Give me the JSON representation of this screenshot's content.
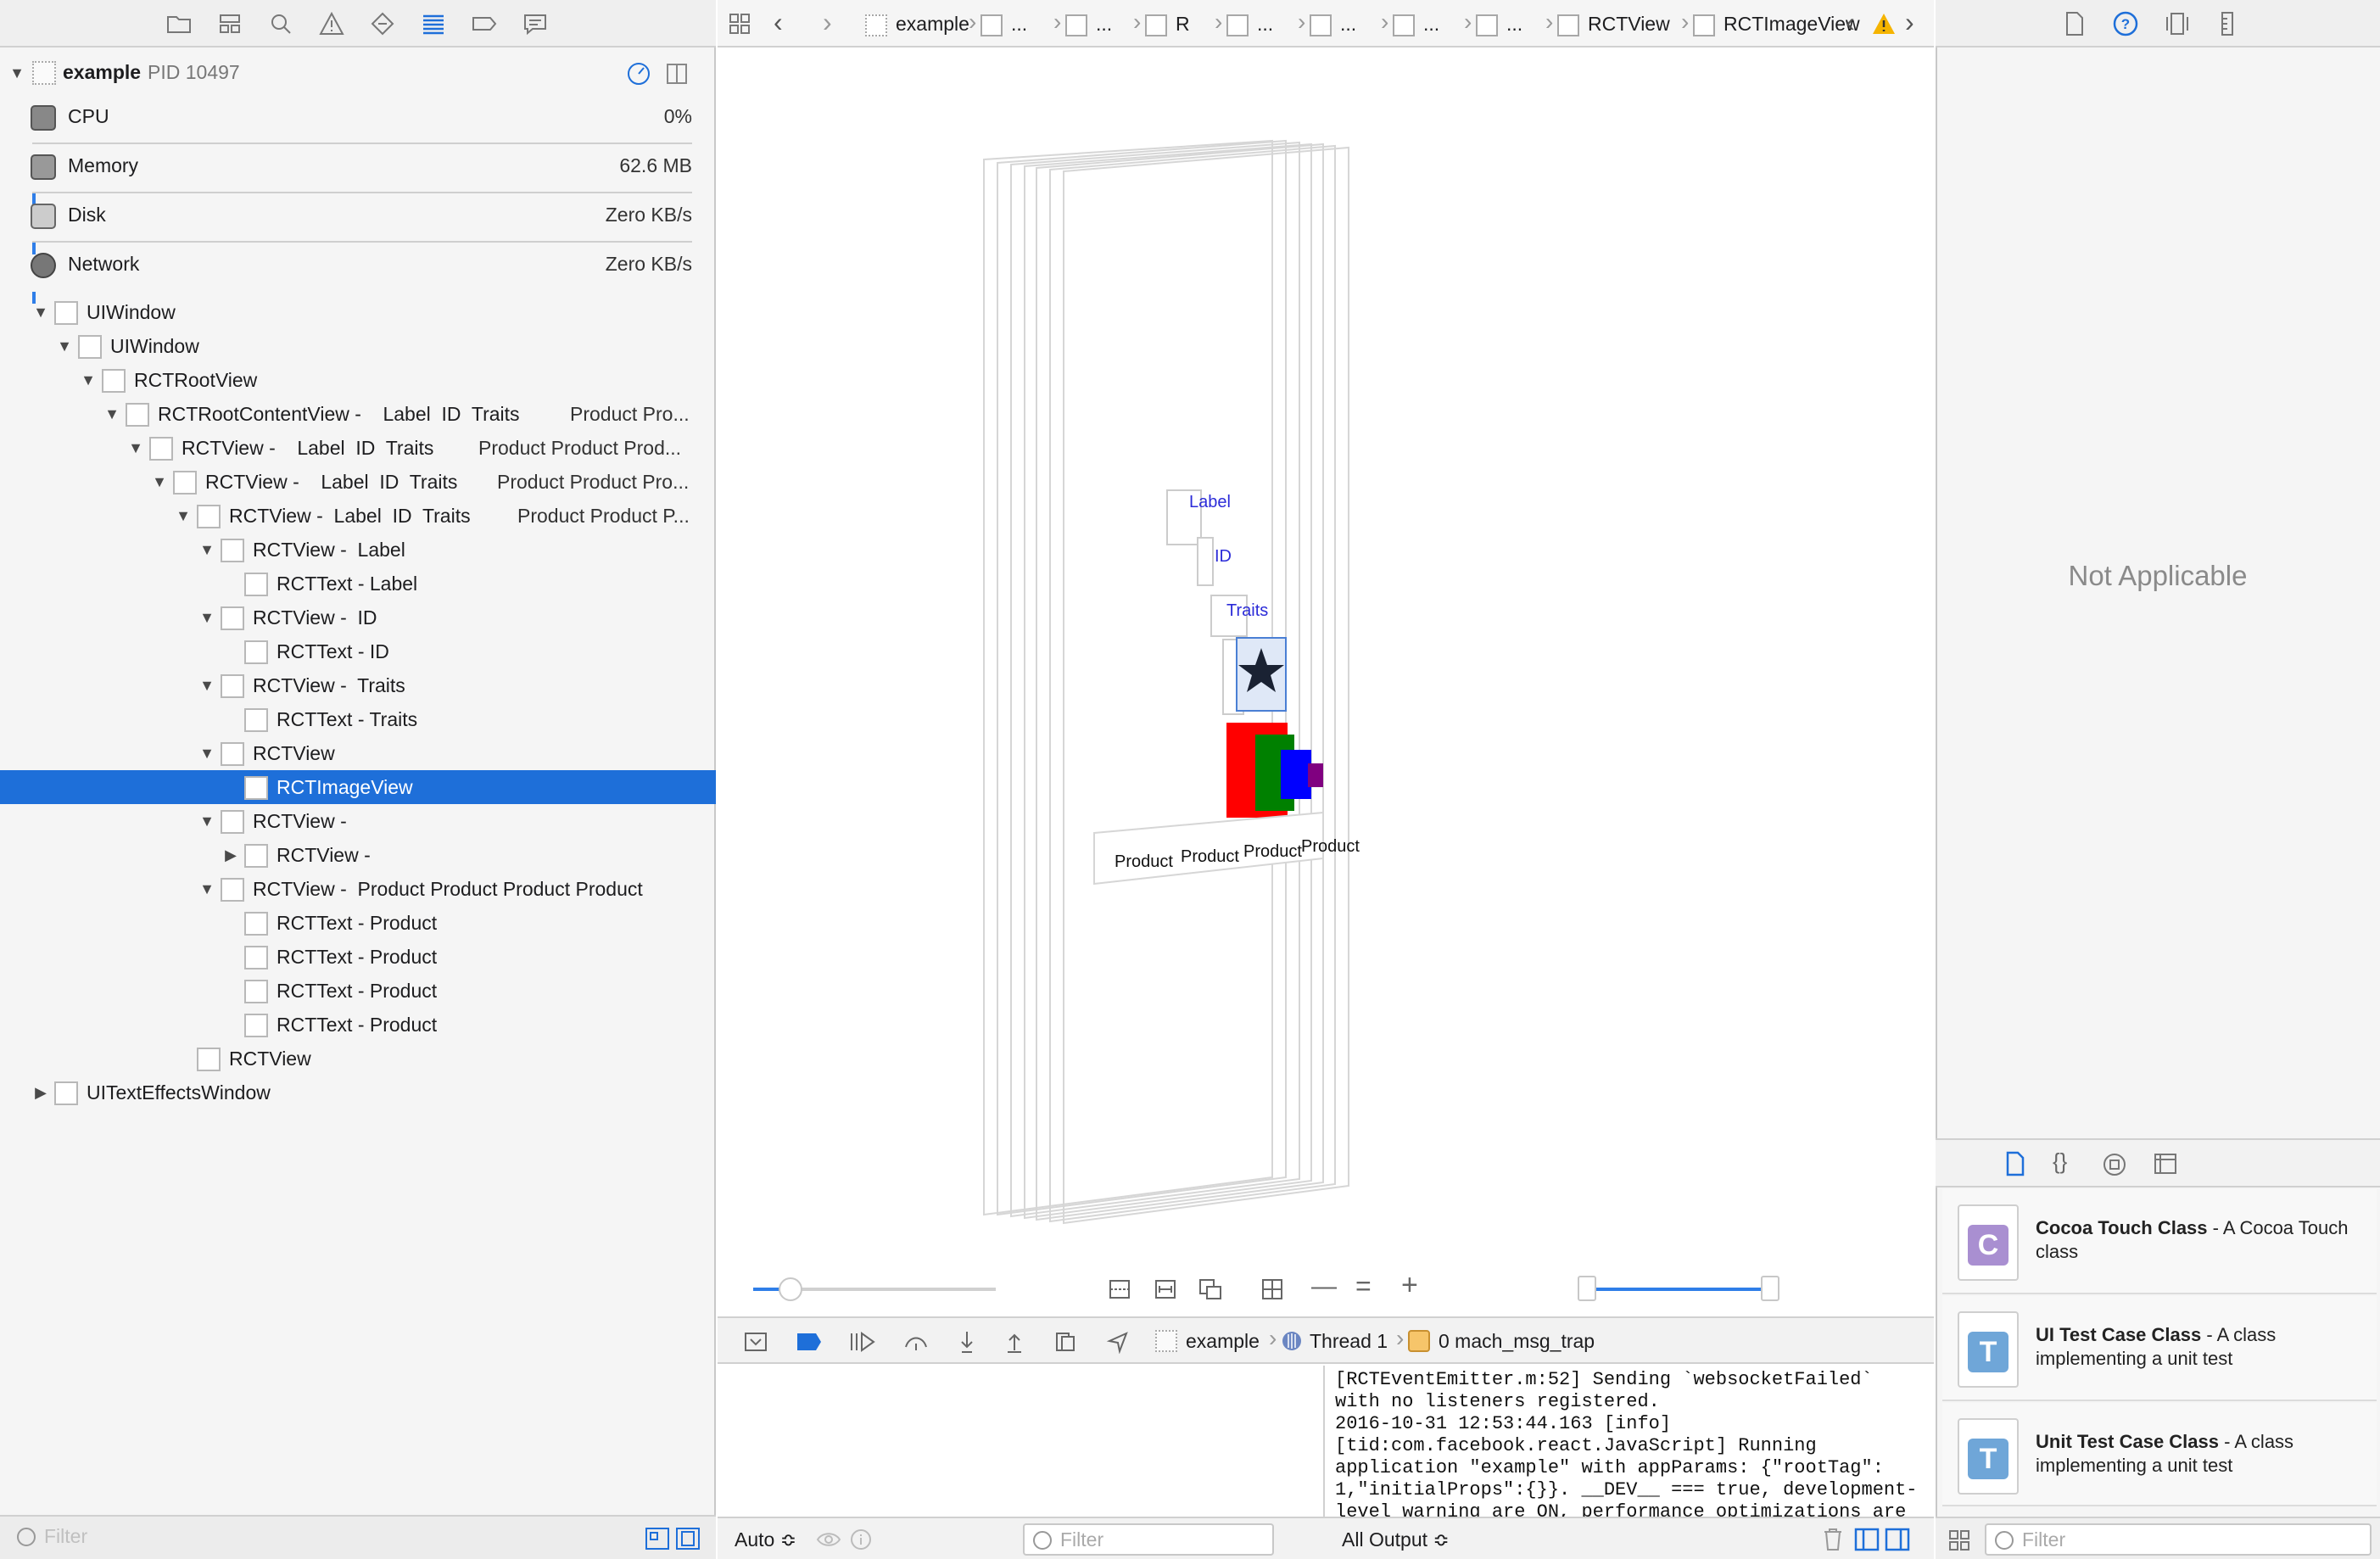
{
  "navigator": {
    "process": {
      "name": "example",
      "pid": "PID 10497"
    },
    "gauges": [
      {
        "label": "CPU",
        "value": "0%"
      },
      {
        "label": "Memory",
        "value": "62.6 MB"
      },
      {
        "label": "Disk",
        "value": "Zero KB/s"
      },
      {
        "label": "Network",
        "value": "Zero KB/s"
      }
    ],
    "tree": [
      {
        "label": "UIWindow",
        "extra": "",
        "indent": 0,
        "expand": "open"
      },
      {
        "label": "UIWindow",
        "extra": "",
        "indent": 1,
        "expand": "open"
      },
      {
        "label": "RCTRootView",
        "extra": "",
        "indent": 2,
        "expand": "open"
      },
      {
        "label": "RCTRootContentView -    Label  ID  Traits",
        "extra": "Product Pro...",
        "indent": 3,
        "expand": "open"
      },
      {
        "label": "RCTView -    Label  ID  Traits",
        "extra": "Product Product Prod...",
        "indent": 4,
        "expand": "open"
      },
      {
        "label": "RCTView -    Label  ID  Traits",
        "extra": "Product Product Pro...",
        "indent": 5,
        "expand": "open"
      },
      {
        "label": "RCTView -  Label  ID  Traits",
        "extra": "Product Product P...",
        "indent": 6,
        "expand": "open"
      },
      {
        "label": "RCTView -  Label",
        "extra": "",
        "indent": 7,
        "expand": "open"
      },
      {
        "label": "RCTText - Label",
        "extra": "",
        "indent": 8,
        "expand": "none"
      },
      {
        "label": "RCTView -  ID",
        "extra": "",
        "indent": 7,
        "expand": "open"
      },
      {
        "label": "RCTText - ID",
        "extra": "",
        "indent": 8,
        "expand": "none"
      },
      {
        "label": "RCTView -  Traits",
        "extra": "",
        "indent": 7,
        "expand": "open"
      },
      {
        "label": "RCTText - Traits",
        "extra": "",
        "indent": 8,
        "expand": "none"
      },
      {
        "label": "RCTView",
        "extra": "",
        "indent": 7,
        "expand": "open"
      },
      {
        "label": "RCTImageView",
        "extra": "",
        "indent": 8,
        "expand": "none",
        "selected": true
      },
      {
        "label": "RCTView -",
        "extra": "",
        "indent": 7,
        "expand": "open"
      },
      {
        "label": "RCTView -",
        "extra": "",
        "indent": 8,
        "expand": "closed"
      },
      {
        "label": "RCTView -  Product Product Product Product",
        "extra": "",
        "indent": 7,
        "expand": "open"
      },
      {
        "label": "RCTText - Product",
        "extra": "",
        "indent": 8,
        "expand": "none"
      },
      {
        "label": "RCTText - Product",
        "extra": "",
        "indent": 8,
        "expand": "none"
      },
      {
        "label": "RCTText - Product",
        "extra": "",
        "indent": 8,
        "expand": "none"
      },
      {
        "label": "RCTText - Product",
        "extra": "",
        "indent": 8,
        "expand": "none"
      },
      {
        "label": "RCTView",
        "extra": "",
        "indent": 6,
        "expand": "none"
      },
      {
        "label": "UITextEffectsWindow",
        "extra": "",
        "indent": 0,
        "expand": "closed"
      }
    ],
    "filter_placeholder": "Filter"
  },
  "jumpbar": {
    "crumbs": [
      "example",
      "...",
      "...",
      "R",
      "...",
      "...",
      "...",
      "...",
      "RCTView",
      "RCTImageView"
    ]
  },
  "canvas": {
    "labels": {
      "label": "Label",
      "id": "ID",
      "traits": "Traits"
    },
    "products": [
      "Product",
      "Product",
      "Product",
      "Product"
    ]
  },
  "debug": {
    "app": "example",
    "thread": "Thread 1",
    "frame": "0 mach_msg_trap"
  },
  "console": {
    "lines": [
      "[RCTEventEmitter.m:52] Sending `websocketFailed`",
      "with no listeners registered.",
      "2016-10-31 12:53:44.163 [info]",
      "[tid:com.facebook.react.JavaScript] Running",
      "application \"example\" with appParams: {\"rootTag\":",
      "1,\"initialProps\":{}}. __DEV__ === true, development-",
      "level warning are ON, performance optimizations are"
    ]
  },
  "bottom": {
    "auto_label": "Auto ≎",
    "filter_placeholder": "Filter",
    "output_label": "All Output ≎"
  },
  "inspector": {
    "not_applicable": "Not Applicable",
    "library": [
      {
        "title": "Cocoa Touch Class",
        "desc": " - A Cocoa Touch class",
        "glyph": "C",
        "color": "#a98fd1"
      },
      {
        "title": "UI Test Case Class",
        "desc": " - A class implementing a unit test",
        "glyph": "T",
        "color": "#6fa6d8"
      },
      {
        "title": "Unit Test Case Class",
        "desc": " - A class implementing a unit test",
        "glyph": "T",
        "color": "#6fa6d8"
      }
    ],
    "filter_placeholder": "Filter"
  },
  "colors": {
    "accent": "#1e6fd9",
    "selection": "#1e6fd9",
    "warning": "#f5b400"
  }
}
